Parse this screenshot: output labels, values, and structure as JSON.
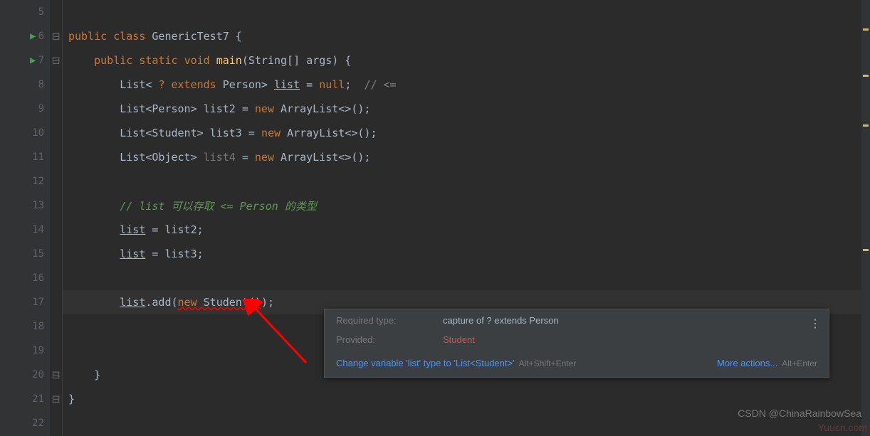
{
  "lines": {
    "5": "5",
    "6": "6",
    "7": "7",
    "8": "8",
    "9": "9",
    "10": "10",
    "11": "11",
    "12": "12",
    "13": "13",
    "14": "14",
    "15": "15",
    "16": "16",
    "17": "17",
    "18": "18",
    "19": "19",
    "20": "20",
    "21": "21",
    "22": "22"
  },
  "code": {
    "l6_public": "public ",
    "l6_class": "class ",
    "l6_name": "GenericTest7 {",
    "l7_indent": "    ",
    "l7_public": "public ",
    "l7_static": "static ",
    "l7_void": "void ",
    "l7_main": "main",
    "l7_paren": "(String[] args) {",
    "l8_indent": "        ",
    "l8_t1": "List< ",
    "l8_q": "? ",
    "l8_ext": "extends ",
    "l8_t2": "Person> ",
    "l8_var": "list",
    "l8_eq": " = ",
    "l8_null": "null",
    "l8_semi": ";  ",
    "l8_cmt": "// <=",
    "l9_indent": "        ",
    "l9_t": "List<Person> list2 = ",
    "l9_new": "new ",
    "l9_arr": "ArrayList<>();",
    "l10_indent": "        ",
    "l10_t": "List<Student> list3 = ",
    "l10_new": "new ",
    "l10_arr": "ArrayList<>();",
    "l11_indent": "        ",
    "l11_t": "List<Object> ",
    "l11_var": "list4",
    "l11_eq": " = ",
    "l11_new": "new ",
    "l11_arr": "ArrayList<>();",
    "l13_indent": "        ",
    "l13_cmt": "// list 可以存取 <= Person 的类型",
    "l14_indent": "        ",
    "l14_var": "list",
    "l14_rest": " = list2;",
    "l15_indent": "        ",
    "l15_var": "list",
    "l15_rest": " = list3;",
    "l17_indent": "        ",
    "l17_var": "list",
    "l17_dot": ".add(",
    "l17_new": "new ",
    "l17_stu": "Student()",
    "l17_end": ");",
    "l20_indent": "    ",
    "l20_brace": "}",
    "l21_brace": "}"
  },
  "tooltip": {
    "reqLabel": "Required type:",
    "reqValue": "capture of ? extends Person",
    "provLabel": "Provided:",
    "provValue": "Student",
    "action1": "Change variable 'list' type to 'List<Student>'",
    "shortcut1": "Alt+Shift+Enter",
    "action2": "More actions...",
    "shortcut2": "Alt+Enter",
    "more": "⋮"
  },
  "watermark1": "CSDN @ChinaRainbowSea",
  "watermark2": "Yuucn.com"
}
